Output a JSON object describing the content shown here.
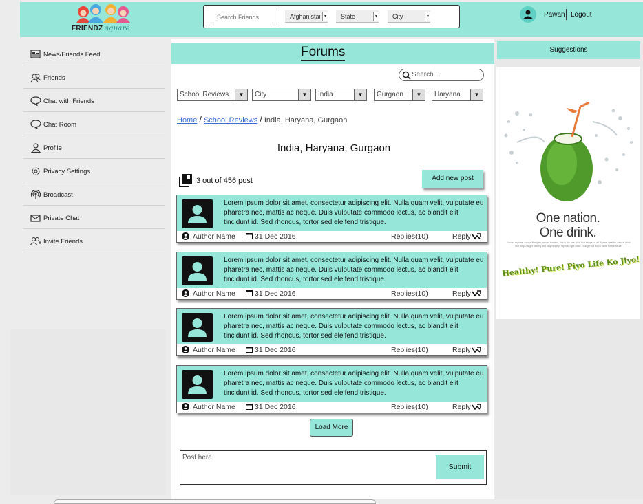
{
  "brand": {
    "name": "FRIENDZ",
    "suffix": "square"
  },
  "header": {
    "search_placeholder": "Search Friends",
    "country": "Afghanistan",
    "state": "State",
    "city": "City",
    "user_name": "Pawan",
    "logout_label": "Logout"
  },
  "sidebar": {
    "items": [
      {
        "label": "News/Friends Feed",
        "icon": "news-icon"
      },
      {
        "label": "Friends",
        "icon": "friends-icon"
      },
      {
        "label": "Chat with Friends",
        "icon": "chat-icon"
      },
      {
        "label": "Chat Room",
        "icon": "chat-room-icon"
      },
      {
        "label": "Profile",
        "icon": "profile-icon"
      },
      {
        "label": "Privacy Settings",
        "icon": "gear-icon"
      },
      {
        "label": "Broadcast",
        "icon": "broadcast-icon"
      },
      {
        "label": "Private Chat",
        "icon": "mail-icon"
      },
      {
        "label": "Invite Friends",
        "icon": "invite-icon"
      }
    ]
  },
  "forum": {
    "title": "Forums",
    "search_placeholder": "Search...",
    "filters": {
      "category": "School Reviews",
      "city": "City",
      "country": "India",
      "district": "Gurgaon",
      "state": "Haryana"
    },
    "breadcrumb": {
      "home": "Home",
      "section": "School Reviews",
      "current": "India, Haryana, Gurgaon"
    },
    "location_title": "India, Haryana, Gurgaon",
    "count_text": "3 out of  456 post",
    "add_post_label": "Add new post",
    "posts": [
      {
        "text": "Lorem ipsum dolor sit amet, consectetur adipiscing elit. Nulla quam velit, vulputate eu pharetra nec, mattis ac neque. Duis vulputate commodo lectus, ac blandit elit tincidunt id. Sed rhoncus, tortor sed eleifend tristique.",
        "author": "Author Name",
        "date": "31 Dec 2016",
        "replies": "Replies(10)",
        "reply_label": "Reply"
      },
      {
        "text": "Lorem ipsum dolor sit amet, consectetur adipiscing elit. Nulla quam velit, vulputate eu pharetra nec, mattis ac neque. Duis vulputate commodo lectus, ac blandit elit tincidunt id. Sed rhoncus, tortor sed eleifend tristique.",
        "author": "Author Name",
        "date": "31 Dec 2016",
        "replies": "Replies(10)",
        "reply_label": "Reply"
      },
      {
        "text": "Lorem ipsum dolor sit amet, consectetur adipiscing elit. Nulla quam velit, vulputate eu pharetra nec, mattis ac neque. Duis vulputate commodo lectus, ac blandit elit tincidunt id. Sed rhoncus, tortor sed eleifend tristique.",
        "author": "Author Name",
        "date": "31 Dec 2016",
        "replies": "Replies(10)",
        "reply_label": "Reply"
      },
      {
        "text": "Lorem ipsum dolor sit amet, consectetur adipiscing elit. Nulla quam velit, vulputate eu pharetra nec, mattis ac neque. Duis vulputate commodo lectus, ac blandit elit tincidunt id. Sed rhoncus, tortor sed eleifend tristique.",
        "author": "Author Name",
        "date": "31 Dec 2016",
        "replies": "Replies(10)",
        "reply_label": "Reply"
      }
    ],
    "load_more_label": "Load More",
    "post_placeholder": "Post here",
    "submit_label": "Submit"
  },
  "suggestions": {
    "title": "Suggestions",
    "ad_slogan_line1": "One nation.",
    "ad_slogan_line2": "One drink.",
    "ad_fine_print": "Across regions, across lifestyles, across borders, this is the one drink that brings us all. A pure, healthy, natural drink that helps us get healthy and stay healthy. Tap into right away - budget will do no harm for the future.",
    "ad_tag": "Healthy! Pure! Piyo Life Ko Jiyo!"
  },
  "colors": {
    "accent": "#96e6da",
    "link": "#3a6fd8"
  }
}
